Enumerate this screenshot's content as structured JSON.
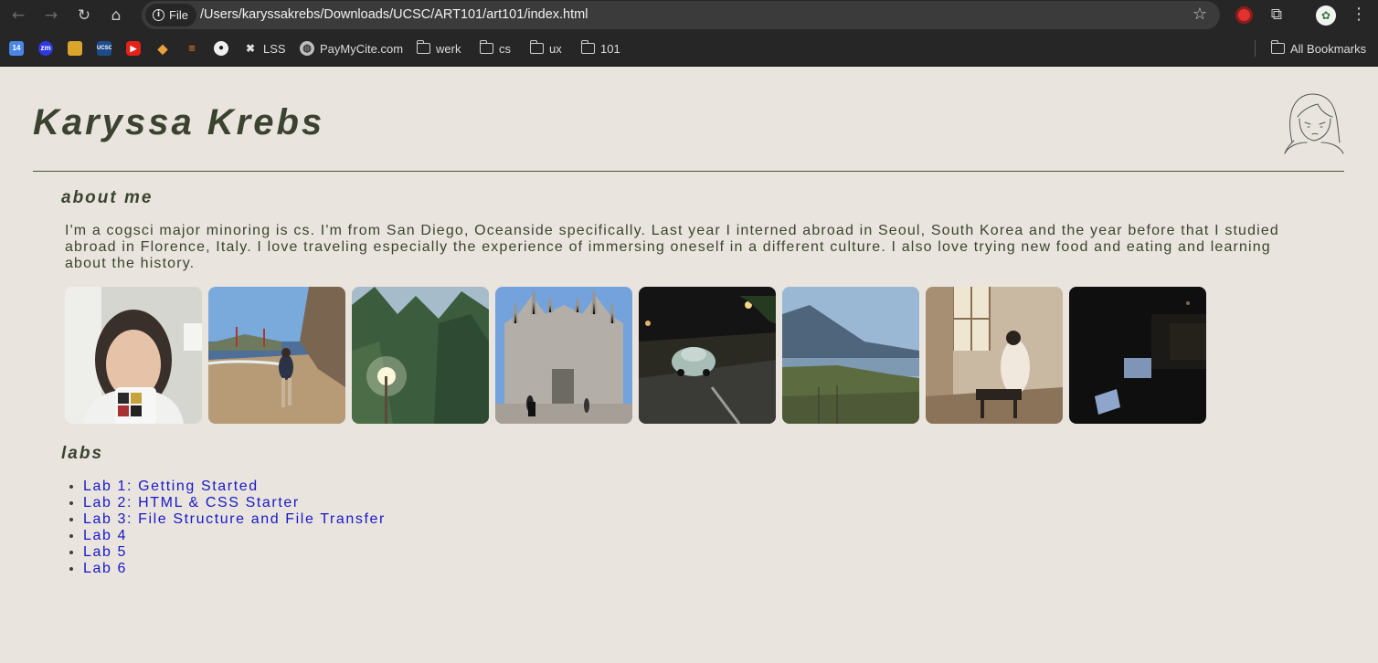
{
  "browser": {
    "site_chip_label": "File",
    "url": "/Users/karyssakrebs/Downloads/UCSC/ART101/art101/index.html",
    "bookmarks": [
      {
        "label": "",
        "icon": "calendar-14-icon"
      },
      {
        "label": "",
        "icon": "zoom-icon"
      },
      {
        "label": "",
        "icon": "canvas-icon"
      },
      {
        "label": "",
        "icon": "ucsc-icon"
      },
      {
        "label": "",
        "icon": "youtube-icon"
      },
      {
        "label": "",
        "icon": "stack-icon"
      },
      {
        "label": "",
        "icon": "stackoverflow-icon"
      },
      {
        "label": "",
        "icon": "github-icon"
      },
      {
        "label": "LSS",
        "icon": "lss-icon"
      },
      {
        "label": "PayMyCite.com",
        "icon": "globe-icon"
      },
      {
        "label": "werk",
        "icon": "folder-icon"
      },
      {
        "label": "cs",
        "icon": "folder-icon"
      },
      {
        "label": "ux",
        "icon": "folder-icon"
      },
      {
        "label": "101",
        "icon": "folder-icon"
      }
    ],
    "all_bookmarks_label": "All Bookmarks",
    "fav_text": {
      "calendar": "14",
      "zoom": "zm",
      "ucsc": "UCSC"
    }
  },
  "page": {
    "title": "Karyssa Krebs",
    "about": {
      "heading": "about me",
      "text": "I'm a cogsci major minoring is cs. I'm from San Diego, Oceanside specifically. Last year I interned abroad in Seoul, South Korea and the year before that I studied abroad in Florence, Italy. I love traveling especially the experience of immersing oneself in a different culture. I also love trying new food and eating and learning about the history."
    },
    "photos": [
      {
        "subject": "selfie-with-mug",
        "colors": [
          "#d8d8d2",
          "#3a3a3a",
          "#f1f1ef"
        ]
      },
      {
        "subject": "beach-golden-gate",
        "colors": [
          "#6d9fd6",
          "#b59a74",
          "#6e5a45"
        ]
      },
      {
        "subject": "forest-sunlight",
        "colors": [
          "#9bb4c2",
          "#3b5a3c",
          "#f6f3d8"
        ]
      },
      {
        "subject": "milan-cathedral",
        "colors": [
          "#6d9ddb",
          "#b0aba4",
          "#7a7670"
        ]
      },
      {
        "subject": "night-car-street",
        "colors": [
          "#1a1a1a",
          "#9db3ab",
          "#c49a55"
        ]
      },
      {
        "subject": "coastal-cliffs",
        "colors": [
          "#8fb1d0",
          "#526b84",
          "#5c6a3e"
        ]
      },
      {
        "subject": "traditional-room",
        "colors": [
          "#cdbfa8",
          "#8a6f55",
          "#2b241e"
        ]
      },
      {
        "subject": "dark-room-screens",
        "colors": [
          "#101010",
          "#2a2620",
          "#9fb6d8"
        ]
      }
    ],
    "labs": {
      "heading": "labs",
      "items": [
        {
          "label": "Lab 1: Getting Started"
        },
        {
          "label": "Lab 2: HTML & CSS Starter"
        },
        {
          "label": "Lab 3: File Structure and File Transfer"
        },
        {
          "label": "Lab 4"
        },
        {
          "label": "Lab 5"
        },
        {
          "label": "Lab 6"
        }
      ]
    },
    "colors": {
      "background": "#e9e5de",
      "text": "#3d4330",
      "link": "#1818c8"
    }
  }
}
